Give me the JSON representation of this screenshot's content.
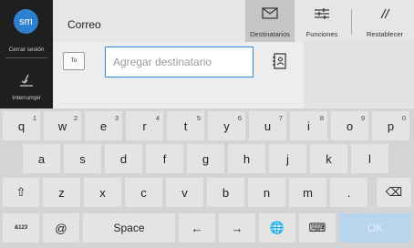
{
  "sidebar": {
    "avatar_initials": "sm",
    "logout_label": "Cerrar sesión",
    "interrupt_label": "Interrumpir"
  },
  "header": {
    "title": "Correo",
    "recipients_label": "Destinatarios",
    "functions_label": "Funciones",
    "reset_label": "Restablecer"
  },
  "recipient": {
    "to_label": "To",
    "placeholder": "Agregar destinatario"
  },
  "keyboard": {
    "row1": [
      {
        "k": "q",
        "n": "1"
      },
      {
        "k": "w",
        "n": "2"
      },
      {
        "k": "e",
        "n": "3"
      },
      {
        "k": "r",
        "n": "4"
      },
      {
        "k": "t",
        "n": "5"
      },
      {
        "k": "y",
        "n": "6"
      },
      {
        "k": "u",
        "n": "7"
      },
      {
        "k": "i",
        "n": "8"
      },
      {
        "k": "o",
        "n": "9"
      },
      {
        "k": "p",
        "n": "0"
      }
    ],
    "row2": [
      "a",
      "s",
      "d",
      "f",
      "g",
      "h",
      "j",
      "k",
      "l"
    ],
    "row3": [
      "z",
      "x",
      "c",
      "v",
      "b",
      "n",
      "m",
      "."
    ],
    "shift_glyph": "⇧",
    "backspace_glyph": "⌫",
    "sym_label": "&123",
    "at_label": "@",
    "space_label": "Space",
    "left_glyph": "←",
    "right_glyph": "→",
    "globe_glyph": "🌐",
    "kbd_glyph": "⌨",
    "ok_label": "OK"
  },
  "colors": {
    "accent": "#2e8ad8",
    "avatar": "#2f7fd0",
    "sidebar_bg": "#1f1f1f",
    "keyboard_bg": "#d4d4d4",
    "key_bg": "#e4e4e4",
    "ok_disabled": "#b9d5ee"
  }
}
